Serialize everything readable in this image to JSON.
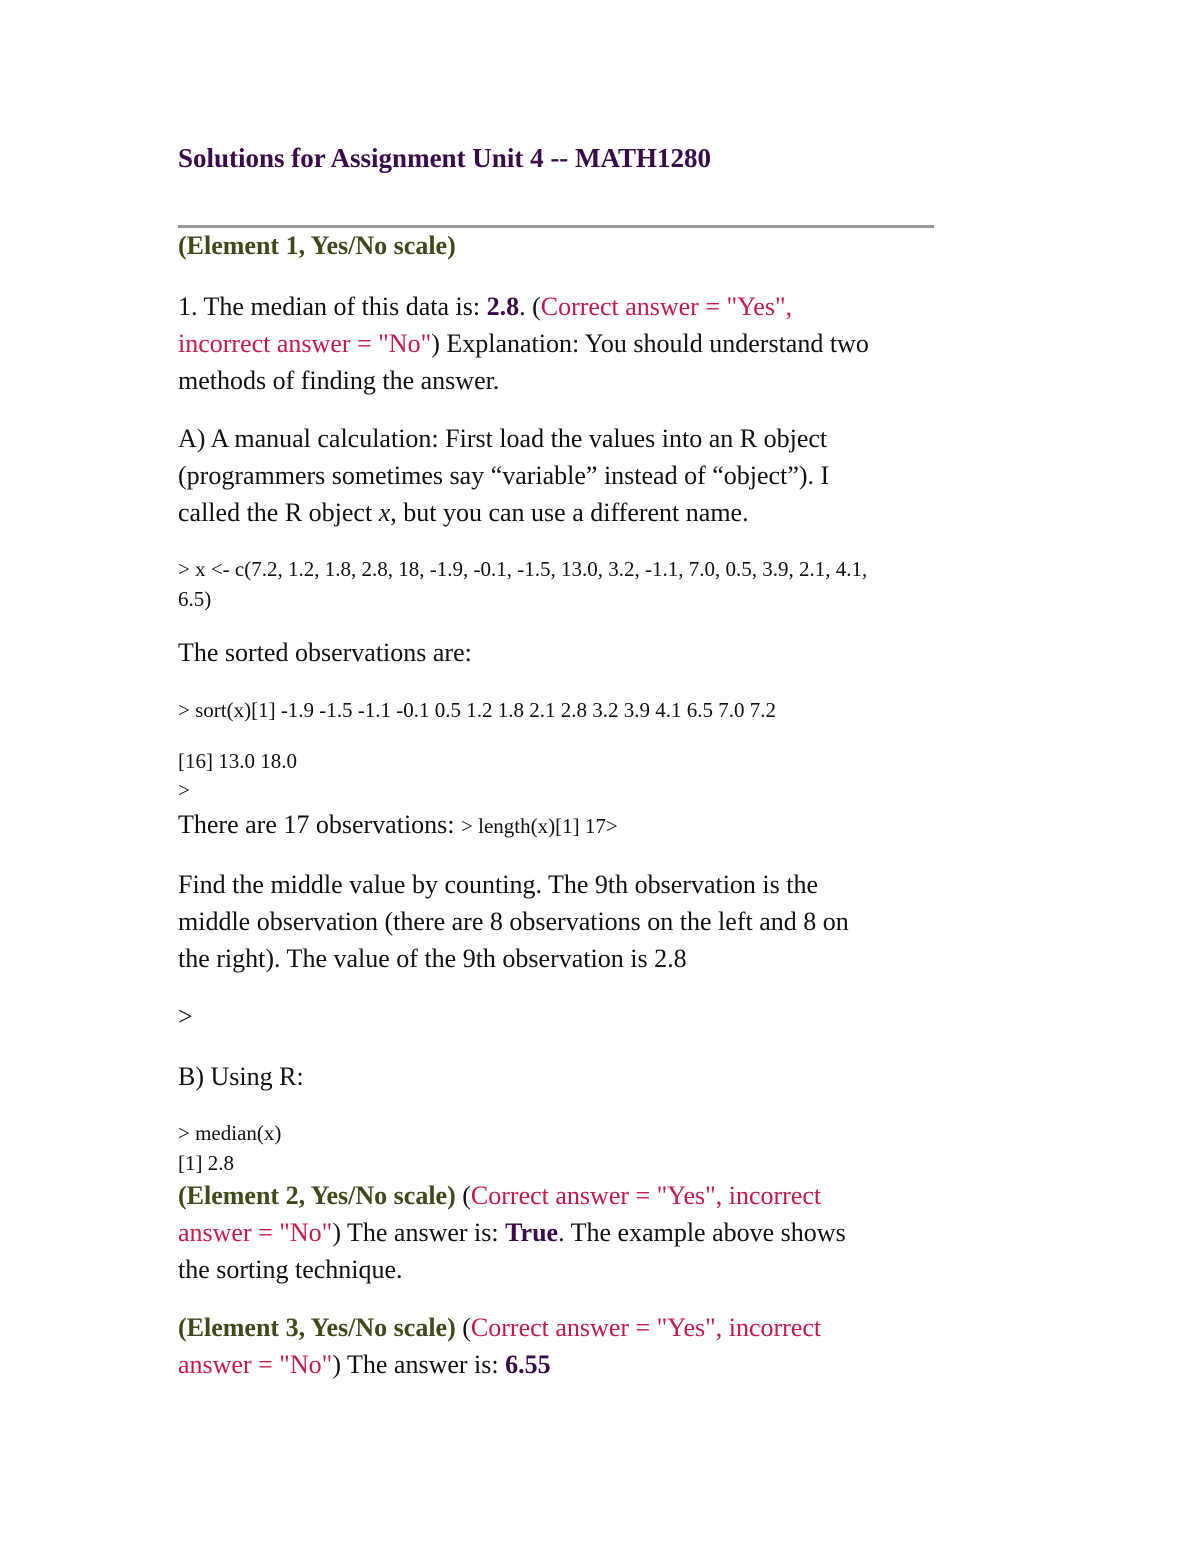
{
  "title": "Solutions for Assignment Unit 4 -- MATH1280",
  "colors": {
    "title": "#3a0a4a",
    "element_heading": "#3f4a1c",
    "note_red": "#c8184a",
    "answer": "#3a0a4a"
  },
  "element1": {
    "heading": "(Element 1, Yes/No scale)",
    "q1_prefix": "1. The median of this data is: ",
    "q1_answer": "2.8",
    "q1_after_answer": ". (",
    "note_line1": "Correct answer = \"Yes\",",
    "note_line2": "incorrect answer = \"No\"",
    "q1_tail_line2": ") Explanation: You should understand two",
    "q1_line3": "methods of finding the answer.",
    "partA_line1": "A) A manual calculation: First load the values into an R object",
    "partA_line2": "(programmers sometimes say “variable” instead of “object”). I",
    "partA_line3_pre": "called the R object ",
    "partA_var": "x",
    "partA_line3_post": ", but you can use a different name.",
    "code_assign_line1": "> x <- c(7.2, 1.2, 1.8, 2.8, 18, -1.9, -0.1, -1.5, 13.0, 3.2, -1.1, 7.0, 0.5, 3.9, 2.1, 4.1,",
    "code_assign_line2": "6.5)",
    "sorted_intro": "The sorted observations are:",
    "sort_output_line1": "> sort(x)[1] -1.9 -1.5 -1.1 -0.1 0.5 1.2 1.8 2.1 2.8 3.2 3.9 4.1 6.5 7.0 7.2",
    "sort_output_line2": "[16] 13.0 18.0",
    "prompt1": ">",
    "count_text": "There are 17 observations: ",
    "count_code": "> length(x)[1] 17>",
    "middle_line1": "Find the middle value by counting. The 9th observation is the",
    "middle_line2": "middle observation (there are 8 observations on the left and 8 on",
    "middle_line3": "the right). The value of the 9th observation is  2.8",
    "prompt2": ">",
    "partB": "B) Using R:",
    "median_cmd": "> median(x)",
    "median_out": "[1] 2.8"
  },
  "element2": {
    "heading": "(Element 2, Yes/No scale)",
    "open": " (",
    "note_line1": "Correct answer = \"Yes\", incorrect",
    "note_line2": "answer = \"No\"",
    "mid": ") The answer is: ",
    "answer": "True",
    "tail": ". The example above shows",
    "line3": "the sorting technique."
  },
  "element3": {
    "heading": "(Element 3, Yes/No scale)",
    "open": " (",
    "note_line1": "Correct answer = \"Yes\", incorrect",
    "note_line2": "answer = \"No\"",
    "mid": ") The answer is: ",
    "answer": "6.55"
  }
}
